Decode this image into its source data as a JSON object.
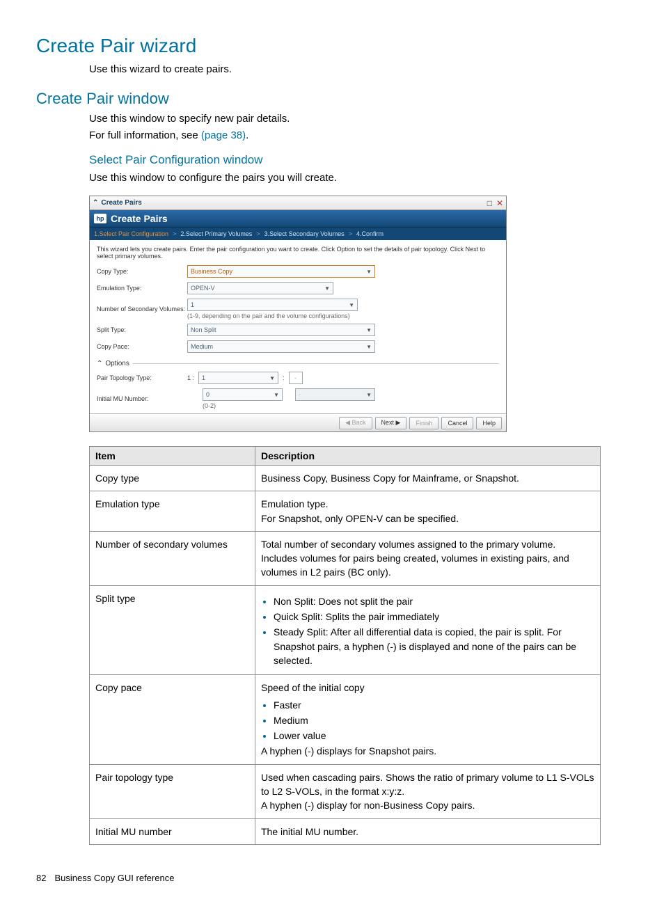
{
  "headings": {
    "h1": "Create Pair wizard",
    "h1_desc": "Use this wizard to create pairs.",
    "h2": "Create Pair window",
    "h2_desc1": "Use this window to specify new pair details.",
    "h2_desc2a": "For full information, see ",
    "h2_desc2b": "(page 38)",
    "h2_desc2c": ".",
    "h3": "Select Pair Configuration window",
    "h3_desc": "Use this window to configure the pairs you will create."
  },
  "screenshot": {
    "win_title": "Create Pairs",
    "banner_title": "Create Pairs",
    "breadcrumb": {
      "b1": "1.Select Pair Configuration",
      "b2": "2.Select Primary Volumes",
      "b3": "3.Select Secondary Volumes",
      "b4": "4.Confirm",
      "sep": ">"
    },
    "instr": "This wizard lets you create pairs. Enter the pair configuration you want to create. Click Option to set the details of pair topology. Click Next to select primary volumes.",
    "labels": {
      "copy_type": "Copy Type:",
      "emulation_type": "Emulation Type:",
      "num_secondary": "Number of Secondary Volumes:",
      "split_type": "Split Type:",
      "copy_pace": "Copy Pace:",
      "options": "Options",
      "pair_topology": "Pair Topology Type:",
      "initial_mu": "Initial MU Number:"
    },
    "values": {
      "copy_type": "Business Copy",
      "emulation_type": "OPEN-V",
      "num_secondary": "1",
      "num_secondary_hint": "(1-9, depending on the pair and the volume configurations)",
      "split_type": "Non Split",
      "copy_pace": "Medium",
      "topology_prefix": "1 :",
      "topology_sel": "1",
      "topology_sep": ":",
      "topology_tail": "-",
      "initial_mu": "0",
      "initial_mu_hint": "(0-2)",
      "initial_mu_tail": "-"
    },
    "buttons": {
      "back": "◀ Back",
      "next": "Next ▶",
      "finish": "Finish",
      "cancel": "Cancel",
      "help": "Help"
    }
  },
  "table": {
    "header_item": "Item",
    "header_desc": "Description",
    "rows": {
      "copy_type": {
        "item": "Copy type",
        "desc": "Business Copy, Business Copy for Mainframe, or Snapshot."
      },
      "emulation": {
        "item": "Emulation type",
        "d1": "Emulation type.",
        "d2": "For Snapshot, only OPEN-V can be specified."
      },
      "num_secondary": {
        "item": "Number of secondary volumes",
        "desc": "Total number of secondary volumes assigned to the primary volume. Includes volumes for pairs being created, volumes in existing pairs, and volumes in L2 pairs (BC only)."
      },
      "split": {
        "item": "Split type",
        "b1": "Non Split: Does not split the pair",
        "b2": "Quick Split: Splits the pair immediately",
        "b3": "Steady Split: After all differential data is copied, the pair is split. For Snapshot pairs, a hyphen (-) is displayed and none of the pairs can be selected."
      },
      "copy_pace": {
        "item": "Copy pace",
        "lead": "Speed of the initial copy",
        "b1": "Faster",
        "b2": "Medium",
        "b3": "Lower value",
        "tail": "A hyphen (-) displays for Snapshot pairs."
      },
      "topology": {
        "item": "Pair topology type",
        "d1": "Used when cascading pairs. Shows the ratio of primary volume to L1 S-VOLs to L2 S-VOLs, in the format x:y:z.",
        "d2": "A hyphen (-) display for non-Business Copy pairs."
      },
      "initial_mu": {
        "item": "Initial MU number",
        "desc": "The initial MU number."
      }
    }
  },
  "footer": {
    "page": "82",
    "text": "Business Copy GUI reference"
  }
}
